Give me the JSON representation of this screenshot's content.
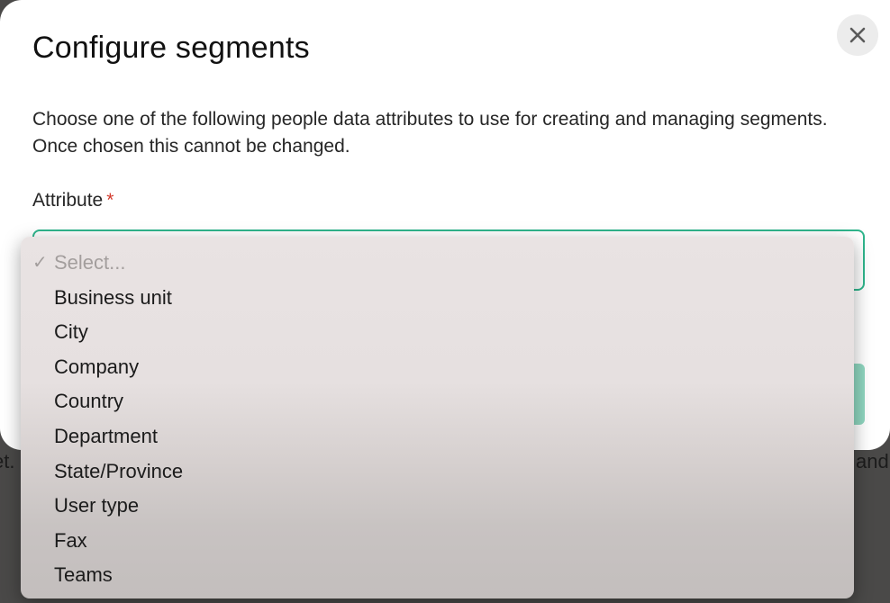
{
  "backdrop": {
    "left_fragment": "et.",
    "right_fragment": "and"
  },
  "modal": {
    "title": "Configure segments",
    "description": "Choose one of the following people data attributes to use for creating and managing segments. Once chosen this cannot be changed.",
    "close_icon": "close-icon",
    "field": {
      "label": "Attribute",
      "required_marker": "*"
    }
  },
  "dropdown": {
    "selected_icon": "checkmark-icon",
    "placeholder": "Select...",
    "options": [
      "Business unit",
      "City",
      "Company",
      "Country",
      "Department",
      "State/Province",
      "User type",
      "Fax",
      "Teams"
    ]
  },
  "colors": {
    "accent": "#2fb58c",
    "button": "#8fd6bf",
    "required": "#d33a2c"
  }
}
